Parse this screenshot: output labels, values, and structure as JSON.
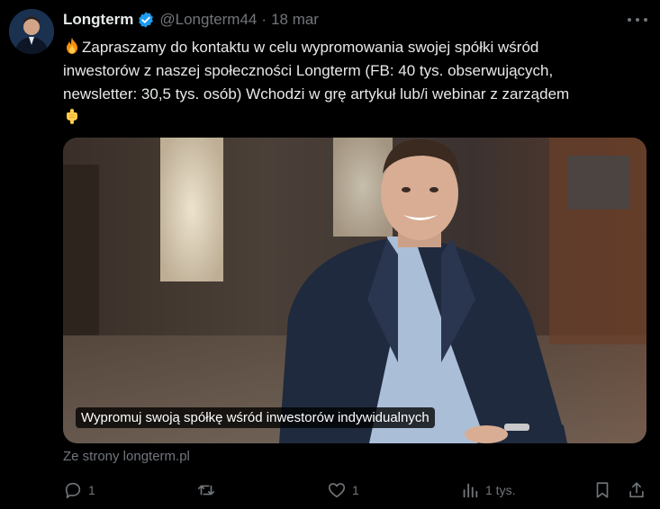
{
  "tweet": {
    "author_name": "Longterm",
    "handle": "@Longterm44",
    "separator": "·",
    "date": "18 mar",
    "text_lines": [
      "Zapraszamy do kontaktu w celu wypromowania swojej spółki wśród",
      "inwestorów z naszej społeczności Longterm (FB: 40 tys. obserwujących,",
      "newsletter: 30,5 tys. osób) Wchodzi w grę artykuł lub/i webinar z zarządem"
    ],
    "leading_emoji": "fire-emoji",
    "trailing_emoji": "pointing-down-emoji"
  },
  "card": {
    "caption": "Wypromuj swoją spółkę wśród inwestorów indywidualnych",
    "source": "Ze strony longterm.pl"
  },
  "actions": {
    "replies": "1",
    "reposts": "",
    "likes": "1",
    "views": "1 tys."
  },
  "colors": {
    "background": "#000000",
    "text": "#e7e9ea",
    "muted": "#71767b",
    "verified": "#1d9bf0"
  }
}
